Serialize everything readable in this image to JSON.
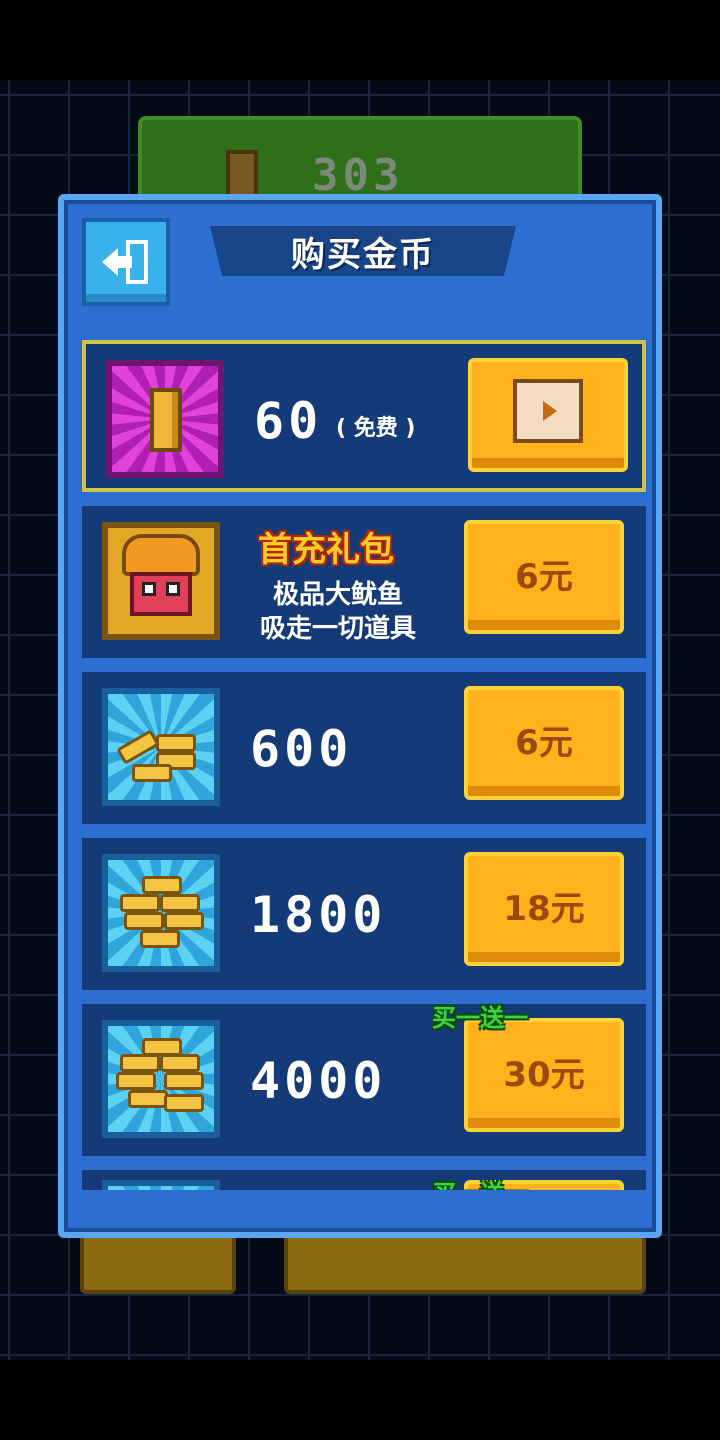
{
  "background": {
    "top_counter_value": "303"
  },
  "dialog": {
    "title": "购买金币",
    "back_icon": "back-exit-icon"
  },
  "items": [
    {
      "amount": "60",
      "note": "( 免费 )",
      "button_icon": "video-play-icon",
      "icon": "single-coin-icon"
    },
    {
      "gift_title": "首充礼包",
      "desc_line1": "极品大鱿鱼",
      "desc_line2": "吸走一切道具",
      "price": "6元",
      "icon": "squid-icon"
    },
    {
      "amount": "600",
      "price": "6元",
      "icon": "coin-stack-small-icon"
    },
    {
      "amount": "1800",
      "price": "18元",
      "icon": "coin-stack-medium-icon"
    },
    {
      "amount": "4000",
      "price": "30元",
      "bonus": "买一送一",
      "icon": "coin-stack-large-icon"
    },
    {
      "bonus": "买一送一"
    }
  ],
  "colors": {
    "panel": "#2c6fd1",
    "row": "#153a78",
    "button": "#ffb21c",
    "highlight": "#d2c24a"
  }
}
